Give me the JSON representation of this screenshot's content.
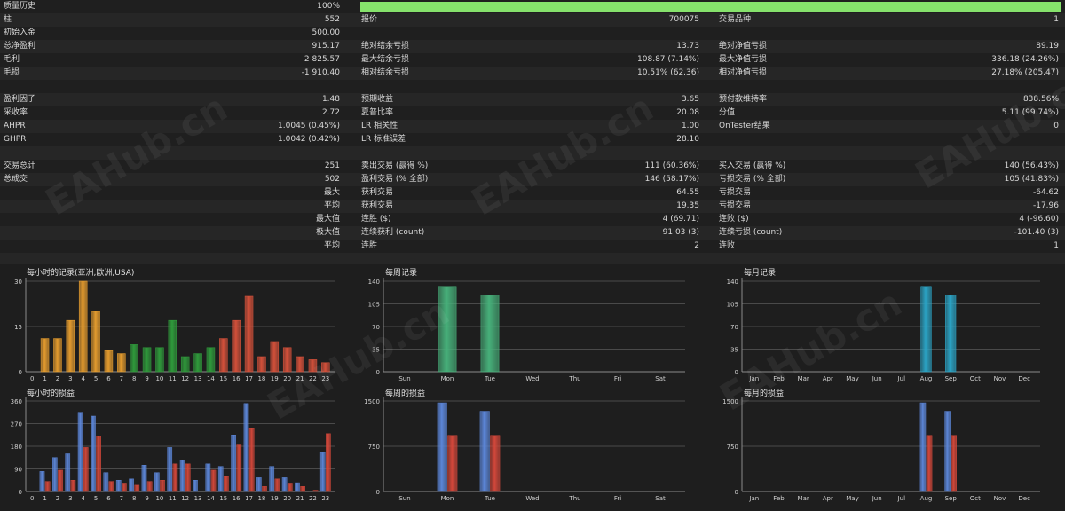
{
  "colors": {
    "hours_asia": "#e39b2e",
    "hours_europe": "#2f9a3b",
    "hours_usa": "#d2503a",
    "weekly_count": "#47b07a",
    "monthly_count": "#2ba3c4",
    "profit": "#5c86d8",
    "loss": "#d2473a",
    "progress": "#86e26c"
  },
  "stats": {
    "quality_label": "质量历史",
    "quality_value": "100%",
    "quality_fraction": 1.0,
    "rows": [
      {
        "c1l": "柱",
        "c1v": "552",
        "c2l": "报价",
        "c2v": "700075",
        "c3l": "交易品种",
        "c3v": "1"
      },
      {
        "c1l": "初始入金",
        "c1v": "500.00",
        "c2l": "",
        "c2v": "",
        "c3l": "",
        "c3v": ""
      },
      {
        "c1l": "总净盈利",
        "c1v": "915.17",
        "c2l": "绝对结余亏损",
        "c2v": "13.73",
        "c3l": "绝对净值亏损",
        "c3v": "89.19"
      },
      {
        "c1l": "毛利",
        "c1v": "2 825.57",
        "c2l": "最大结余亏损",
        "c2v": "108.87 (7.14%)",
        "c3l": "最大净值亏损",
        "c3v": "336.18 (24.26%)"
      },
      {
        "c1l": "毛损",
        "c1v": "-1 910.40",
        "c2l": "相对结余亏损",
        "c2v": "10.51% (62.36)",
        "c3l": "相对净值亏损",
        "c3v": "27.18% (205.47)"
      },
      {
        "c1l": "",
        "c1v": "",
        "c2l": "",
        "c2v": "",
        "c3l": "",
        "c3v": ""
      },
      {
        "c1l": "盈利因子",
        "c1v": "1.48",
        "c2l": "预期收益",
        "c2v": "3.65",
        "c3l": "预付款维持率",
        "c3v": "838.56%"
      },
      {
        "c1l": "采收率",
        "c1v": "2.72",
        "c2l": "夏普比率",
        "c2v": "20.08",
        "c3l": "分值",
        "c3v": "5.11 (99.74%)"
      },
      {
        "c1l": "AHPR",
        "c1v": "1.0045 (0.45%)",
        "c2l": "LR 相关性",
        "c2v": "1.00",
        "c3l": "OnTester结果",
        "c3v": "0"
      },
      {
        "c1l": "GHPR",
        "c1v": "1.0042 (0.42%)",
        "c2l": "LR 标准误差",
        "c2v": "28.10",
        "c3l": "",
        "c3v": ""
      },
      {
        "c1l": "",
        "c1v": "",
        "c2l": "",
        "c2v": "",
        "c3l": "",
        "c3v": ""
      },
      {
        "c1l": "交易总计",
        "c1v": "251",
        "c2l": "卖出交易 (赢得 %)",
        "c2v": "111 (60.36%)",
        "c3l": "买入交易 (赢得 %)",
        "c3v": "140 (56.43%)"
      },
      {
        "c1l": "总成交",
        "c1v": "502",
        "c2l": "盈利交易 (% 全部)",
        "c2v": "146 (58.17%)",
        "c3l": "亏损交易 (% 全部)",
        "c3v": "105 (41.83%)"
      },
      {
        "c1l": "",
        "c1v": "最大",
        "c2l": "获利交易",
        "c2v": "64.55",
        "c3l": "亏损交易",
        "c3v": "-64.62"
      },
      {
        "c1l": "",
        "c1v": "平均",
        "c2l": "获利交易",
        "c2v": "19.35",
        "c3l": "亏损交易",
        "c3v": "-17.96"
      },
      {
        "c1l": "",
        "c1v": "最大值",
        "c2l": "连胜 ($)",
        "c2v": "4 (69.71)",
        "c3l": "连败 ($)",
        "c3v": "4 (-96.60)"
      },
      {
        "c1l": "",
        "c1v": "极大值",
        "c2l": "连续获利 (count)",
        "c2v": "91.03 (3)",
        "c3l": "连续亏损 (count)",
        "c3v": "-101.40 (3)"
      },
      {
        "c1l": "",
        "c1v": "平均",
        "c2l": "连胜",
        "c2v": "2",
        "c3l": "连败",
        "c3v": "1"
      }
    ]
  },
  "watermark": "EAHub.cn",
  "chart_data": [
    {
      "type": "bar",
      "title": "每小时的记录(亚洲,欧洲,USA)",
      "categories": [
        "0",
        "1",
        "2",
        "3",
        "4",
        "5",
        "6",
        "7",
        "8",
        "9",
        "10",
        "11",
        "12",
        "13",
        "14",
        "15",
        "16",
        "17",
        "18",
        "19",
        "20",
        "21",
        "22",
        "23"
      ],
      "values": [
        0,
        11,
        11,
        17,
        30,
        20,
        7,
        6,
        9,
        8,
        8,
        17,
        5,
        6,
        8,
        11,
        17,
        25,
        5,
        10,
        8,
        5,
        4,
        3
      ],
      "ylim": [
        0,
        30
      ],
      "yticks": [
        "0",
        "15",
        "30"
      ],
      "grid": true
    },
    {
      "type": "bar",
      "title": "每周记录",
      "categories": [
        "Sun",
        "Mon",
        "Tue",
        "Wed",
        "Thu",
        "Fri",
        "Sat"
      ],
      "values": [
        0,
        132,
        119,
        0,
        0,
        0,
        0
      ],
      "ylim": [
        0,
        140
      ],
      "yticks": [
        "0",
        "35",
        "70",
        "105",
        "140"
      ],
      "grid": true
    },
    {
      "type": "bar",
      "title": "每月记录",
      "categories": [
        "Jan",
        "Feb",
        "Mar",
        "Apr",
        "May",
        "Jun",
        "Jul",
        "Aug",
        "Sep",
        "Oct",
        "Nov",
        "Dec"
      ],
      "values": [
        0,
        0,
        0,
        0,
        0,
        0,
        0,
        132,
        119,
        0,
        0,
        0
      ],
      "ylim": [
        0,
        140
      ],
      "yticks": [
        "0",
        "35",
        "70",
        "105",
        "140"
      ],
      "grid": true
    },
    {
      "type": "bar",
      "title": "每小时的损益",
      "categories": [
        "0",
        "1",
        "2",
        "3",
        "4",
        "5",
        "6",
        "7",
        "8",
        "9",
        "10",
        "11",
        "12",
        "13",
        "14",
        "15",
        "16",
        "17",
        "18",
        "19",
        "20",
        "21",
        "22",
        "23"
      ],
      "series": [
        {
          "values": [
            0,
            80,
            135,
            150,
            315,
            300,
            75,
            45,
            50,
            105,
            75,
            175,
            125,
            45,
            110,
            100,
            225,
            350,
            55,
            100,
            55,
            35,
            0,
            155
          ]
        },
        {
          "values": [
            0,
            40,
            85,
            45,
            175,
            220,
            40,
            30,
            25,
            40,
            45,
            110,
            110,
            0,
            85,
            60,
            185,
            250,
            20,
            50,
            30,
            20,
            5,
            230
          ]
        }
      ],
      "ylim": [
        0,
        360
      ],
      "yticks": [
        "0",
        "90",
        "180",
        "270",
        "360"
      ],
      "grid": true
    },
    {
      "type": "bar",
      "title": "每周的损益",
      "categories": [
        "Sun",
        "Mon",
        "Tue",
        "Wed",
        "Thu",
        "Fri",
        "Sat"
      ],
      "series": [
        {
          "values": [
            0,
            1470,
            1330,
            0,
            0,
            0,
            0
          ]
        },
        {
          "values": [
            0,
            930,
            930,
            0,
            0,
            0,
            0
          ]
        }
      ],
      "ylim": [
        0,
        1500
      ],
      "yticks": [
        "0",
        "750",
        "1500"
      ],
      "grid": true
    },
    {
      "type": "bar",
      "title": "每月的损益",
      "categories": [
        "Jan",
        "Feb",
        "Mar",
        "Apr",
        "May",
        "Jun",
        "Jul",
        "Aug",
        "Sep",
        "Oct",
        "Nov",
        "Dec"
      ],
      "series": [
        {
          "values": [
            0,
            0,
            0,
            0,
            0,
            0,
            0,
            1470,
            1330,
            0,
            0,
            0
          ]
        },
        {
          "values": [
            0,
            0,
            0,
            0,
            0,
            0,
            0,
            930,
            930,
            0,
            0,
            0
          ]
        }
      ],
      "ylim": [
        0,
        1500
      ],
      "yticks": [
        "0",
        "750",
        "1500"
      ],
      "grid": true
    }
  ]
}
